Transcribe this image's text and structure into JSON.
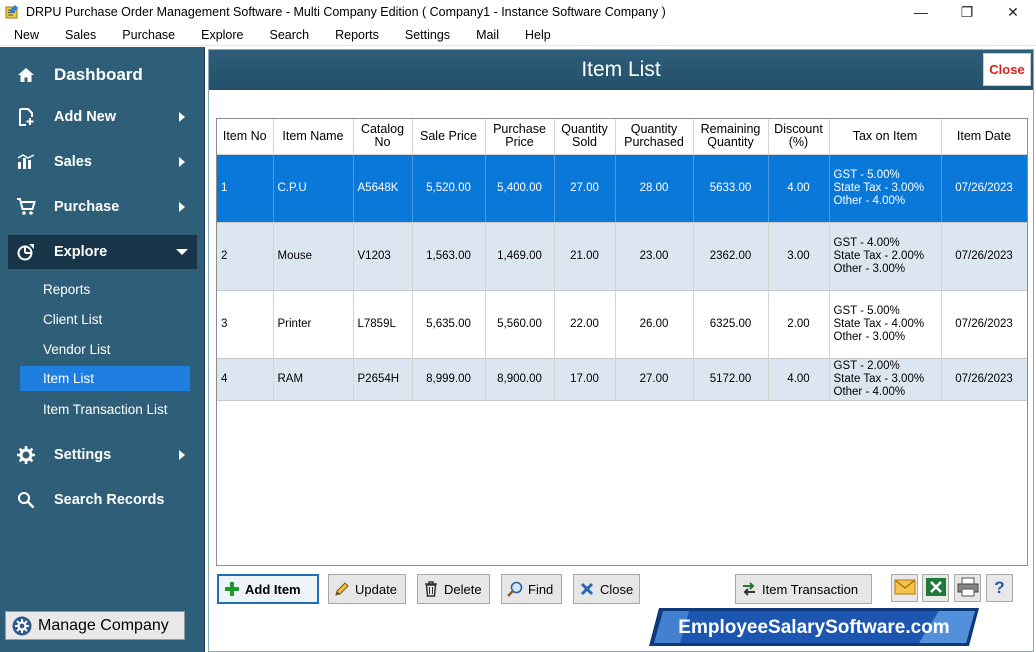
{
  "window": {
    "title": "DRPU Purchase Order Management Software - Multi Company Edition ( Company1 - Instance Software Company )",
    "controls": {
      "minimize": "—",
      "maximize": "❐",
      "close": "✕"
    }
  },
  "menu": [
    "New",
    "Sales",
    "Purchase",
    "Explore",
    "Search",
    "Reports",
    "Settings",
    "Mail",
    "Help"
  ],
  "sidebar": {
    "dashboard": "Dashboard",
    "add_new": "Add New",
    "sales": "Sales",
    "purchase": "Purchase",
    "explore": "Explore",
    "explore_items": [
      "Reports",
      "Client List",
      "Vendor List",
      "Item List",
      "Item Transaction List"
    ],
    "settings": "Settings",
    "search_records": "Search Records",
    "manage_company": "Manage Company"
  },
  "main": {
    "title": "Item List",
    "close_link": "Close"
  },
  "table": {
    "columns": [
      [
        "Item No"
      ],
      [
        "Item Name"
      ],
      [
        "Catalog",
        "No"
      ],
      [
        "Sale Price"
      ],
      [
        "Purchase",
        "Price"
      ],
      [
        "Quantity",
        "Sold"
      ],
      [
        "Quantity",
        "Purchased"
      ],
      [
        "Remaining",
        "Quantity"
      ],
      [
        "Discount",
        "(%)"
      ],
      [
        "Tax on Item"
      ],
      [
        "Item Date"
      ]
    ],
    "rows": [
      {
        "no": "1",
        "name": "C.P.U",
        "catalog": "A5648K",
        "sale": "5,520.00",
        "purchase": "5,400.00",
        "sold": "27.00",
        "purchased": "28.00",
        "remaining": "5633.00",
        "discount": "4.00",
        "tax": [
          "GST - 5.00%",
          "State Tax - 3.00%",
          "Other - 4.00%"
        ],
        "date": "07/26/2023"
      },
      {
        "no": "2",
        "name": "Mouse",
        "catalog": "V1203",
        "sale": "1,563.00",
        "purchase": "1,469.00",
        "sold": "21.00",
        "purchased": "23.00",
        "remaining": "2362.00",
        "discount": "3.00",
        "tax": [
          "GST - 4.00%",
          "State Tax - 2.00%",
          "Other - 3.00%"
        ],
        "date": "07/26/2023"
      },
      {
        "no": "3",
        "name": "Printer",
        "catalog": "L7859L",
        "sale": "5,635.00",
        "purchase": "5,560.00",
        "sold": "22.00",
        "purchased": "26.00",
        "remaining": "6325.00",
        "discount": "2.00",
        "tax": [
          "GST - 5.00%",
          "State Tax - 4.00%",
          "Other - 3.00%"
        ],
        "date": "07/26/2023"
      },
      {
        "no": "4",
        "name": "RAM",
        "catalog": "P2654H",
        "sale": "8,999.00",
        "purchase": "8,900.00",
        "sold": "17.00",
        "purchased": "27.00",
        "remaining": "5172.00",
        "discount": "4.00",
        "tax": [
          "GST - 2.00%",
          "State Tax - 3.00%",
          "Other - 4.00%"
        ],
        "date": "07/26/2023"
      }
    ]
  },
  "toolbar": {
    "add_item": "Add Item",
    "update": "Update",
    "delete": "Delete",
    "find": "Find",
    "close": "Close",
    "item_transaction": "Item Transaction",
    "help": "?"
  },
  "banner": {
    "text": "EmployeeSalarySoftware.com"
  },
  "colors": {
    "sidebar": "#2e5e78",
    "sidebar_active": "#173448",
    "selection": "#0a78d8",
    "close_red": "#e21b1b"
  }
}
